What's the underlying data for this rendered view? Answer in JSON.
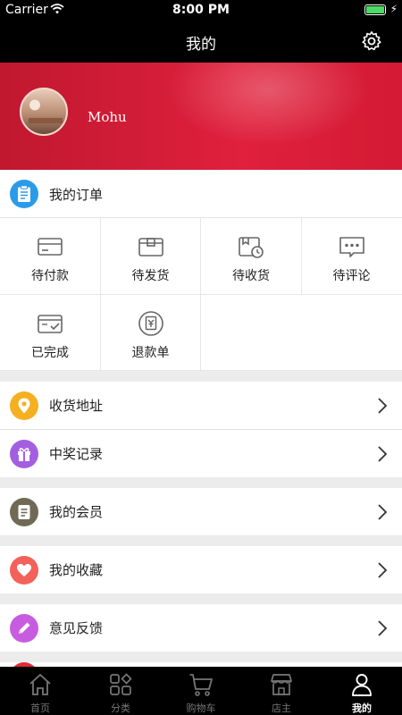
{
  "status_bar": {
    "carrier": "Carrier",
    "time": "8:00 PM"
  },
  "nav": {
    "title": "我的",
    "settings_icon": "gear-icon"
  },
  "profile": {
    "username": "Mohu"
  },
  "orders": {
    "header_label": "我的订单",
    "header_icon": "clipboard-icon",
    "items": [
      {
        "label": "待付款",
        "icon": "card-icon"
      },
      {
        "label": "待发货",
        "icon": "box-icon"
      },
      {
        "label": "待收货",
        "icon": "delivery-clock-icon"
      },
      {
        "label": "待评论",
        "icon": "comment-icon"
      },
      {
        "label": "已完成",
        "icon": "completed-box-icon"
      },
      {
        "label": "退款单",
        "icon": "refund-icon"
      }
    ]
  },
  "menu": [
    {
      "label": "收货地址",
      "icon": "location-pin-icon",
      "color": "#f5b021"
    },
    {
      "label": "中奖记录",
      "icon": "gift-icon",
      "color": "#a45fe0"
    },
    {
      "label": "我的会员",
      "icon": "member-card-icon",
      "color": "#6f6a55"
    },
    {
      "label": "我的收藏",
      "icon": "heart-icon",
      "color": "#f2615a"
    },
    {
      "label": "意见反馈",
      "icon": "pencil-icon",
      "color": "#c85ce0"
    }
  ],
  "tabbar": {
    "items": [
      {
        "label": "首页",
        "icon": "home-icon"
      },
      {
        "label": "分类",
        "icon": "category-grid-icon"
      },
      {
        "label": "购物车",
        "icon": "cart-icon"
      },
      {
        "label": "店主",
        "icon": "store-icon"
      },
      {
        "label": "我的",
        "icon": "user-icon"
      }
    ],
    "active": "我的"
  },
  "colors": {
    "hero_red": "#d41a34",
    "nav_black": "#000000",
    "order_blue": "#2b9be9"
  }
}
